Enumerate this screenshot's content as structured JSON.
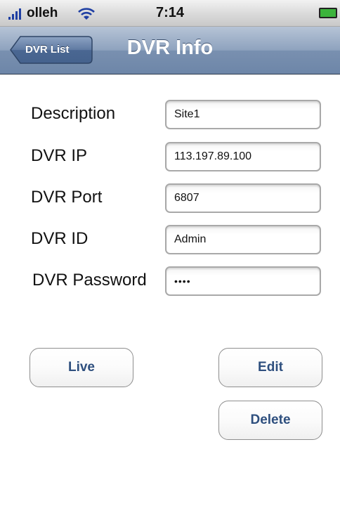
{
  "status_bar": {
    "carrier": "olleh",
    "time": "7:14",
    "icons": [
      "signal-icon",
      "wifi-icon",
      "battery-icon"
    ]
  },
  "nav": {
    "back_label": "DVR List",
    "title": "DVR Info"
  },
  "form": {
    "fields": [
      {
        "label": "Description",
        "value": "Site1"
      },
      {
        "label": "DVR IP",
        "value": "113.197.89.100"
      },
      {
        "label": "DVR Port",
        "value": "6807"
      },
      {
        "label": "DVR ID",
        "value": "Admin"
      },
      {
        "label": "DVR Password",
        "value": "••••"
      }
    ]
  },
  "actions": {
    "live_label": "Live",
    "edit_label": "Edit",
    "delete_label": "Delete"
  },
  "colors": {
    "nav_bar": "#7990b0",
    "button_text": "#2e4f7e",
    "signal": "#1f3fa3",
    "battery": "#3cb43c"
  }
}
